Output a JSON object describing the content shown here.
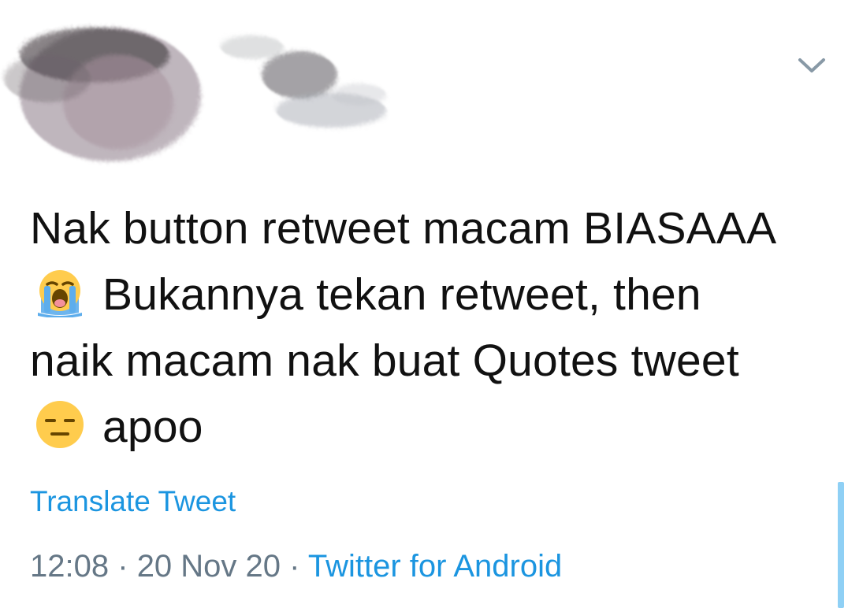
{
  "tweet": {
    "text_part1": "Nak button retweet macam BIASAAA",
    "emoji_1": "loudly-crying-face-icon",
    "text_part2": "Bukannya tekan retweet, then naik macam nak buat Quotes tweet",
    "emoji_2": "expressionless-face-icon",
    "text_part3": "apoo",
    "translate_label": "Translate Tweet",
    "time": "12:08",
    "separator": "·",
    "date": "20 Nov 20",
    "source": "Twitter for Android"
  },
  "icons": {
    "menu_caret": "chevron-down-icon"
  },
  "colors": {
    "text": "#111111",
    "link": "#1b95e0",
    "muted": "#657786",
    "scroll_indicator": "#8fd0f5"
  }
}
